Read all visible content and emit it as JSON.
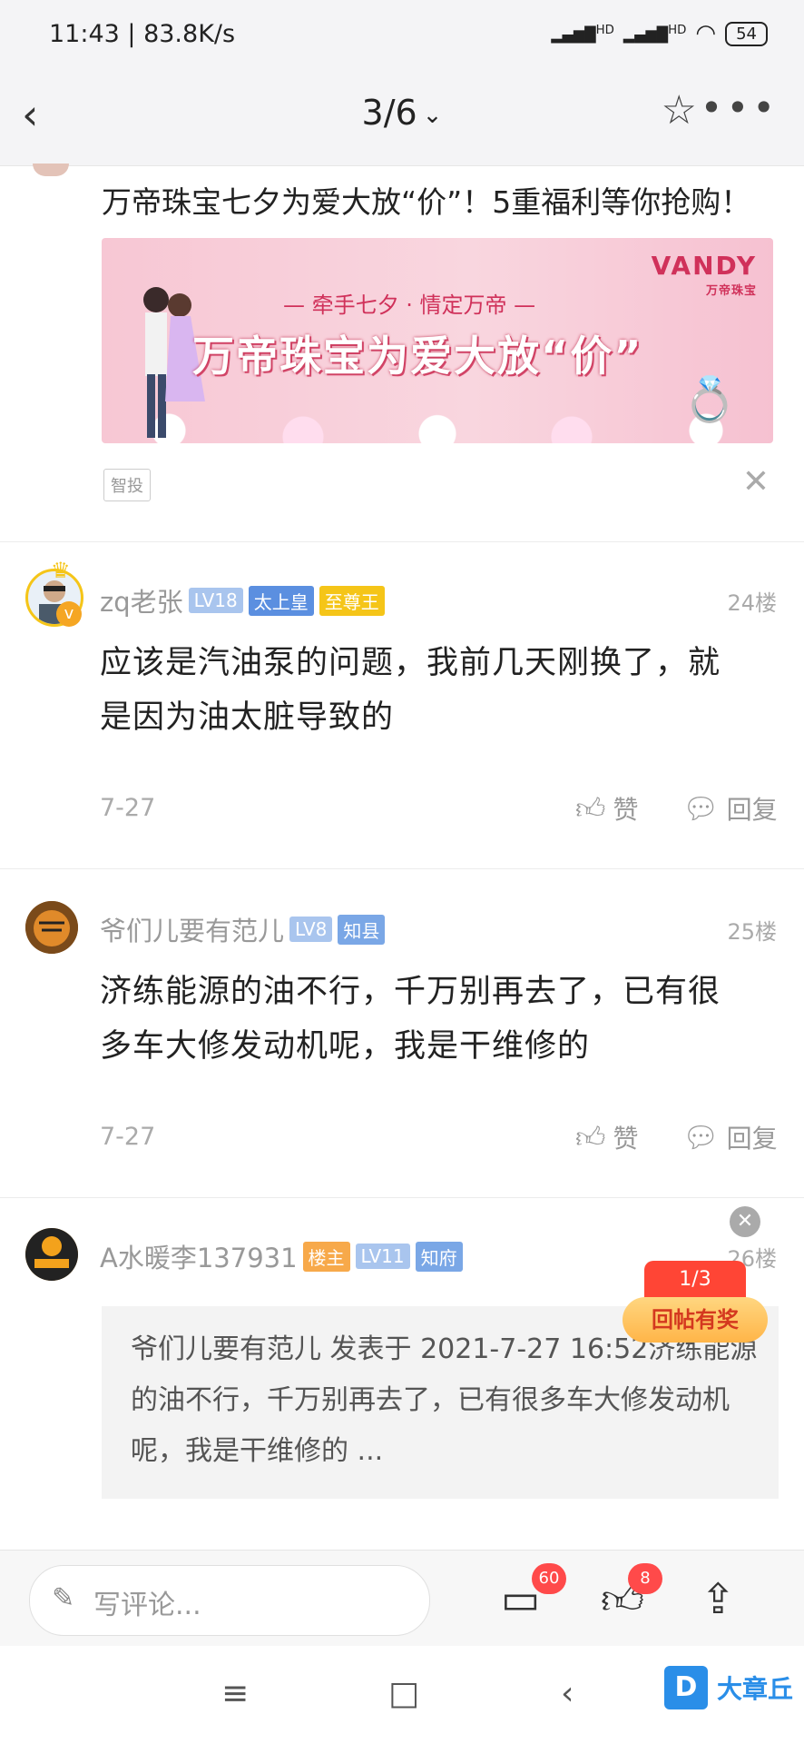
{
  "status_bar": {
    "time": "11:43 | 83.8K/s",
    "signal_1": "HD",
    "signal_2": "HD",
    "battery": "54"
  },
  "nav": {
    "page_indicator": "3/6"
  },
  "ad": {
    "title": "万帝珠宝七夕为爱大放“价”！5重福利等你抢购！",
    "banner_brand": "VANDY",
    "banner_brand_cn": "万帝珠宝",
    "banner_sub": "— 牵手七夕 · 情定万帝 —",
    "banner_main": "万帝珠宝为爱大放“价”",
    "tag": "智投"
  },
  "posts": [
    {
      "username": "zq老张",
      "badges": [
        "LV18",
        "太上皇",
        "至尊王"
      ],
      "floor": "24楼",
      "content": "应该是汽油泵的问题，我前几天刚换了，就是因为油太脏导致的",
      "date": "7-27",
      "like_label": "赞",
      "reply_label": "回复"
    },
    {
      "username": "爷们儿要有范儿",
      "badges": [
        "LV8",
        "知县"
      ],
      "floor": "25楼",
      "content": "济练能源的油不行，千万别再去了，已有很多车大修发动机呢，我是干维修的",
      "date": "7-27",
      "like_label": "赞",
      "reply_label": "回复"
    },
    {
      "username": "A水暖李137931",
      "badges": [
        "楼主",
        "LV11",
        "知府"
      ],
      "floor": "26楼",
      "quote": "爷们儿要有范儿 发表于 2021-7-27 16:52济练能源的油不行，千万别再去了，已有很多车大修发动机呢，我是干维修的 ..."
    }
  ],
  "floating": {
    "page": "1/3",
    "label": "回帖有奖"
  },
  "bottom_bar": {
    "placeholder": "写评论...",
    "comments_count": "60",
    "likes_count": "8"
  },
  "watermark": {
    "text": "大章丘"
  },
  "colors": {
    "accent": "#ff4a4a",
    "badge_blue": "#7aa7e6",
    "badge_gold": "#f5c518",
    "badge_orange": "#f7a94a"
  }
}
